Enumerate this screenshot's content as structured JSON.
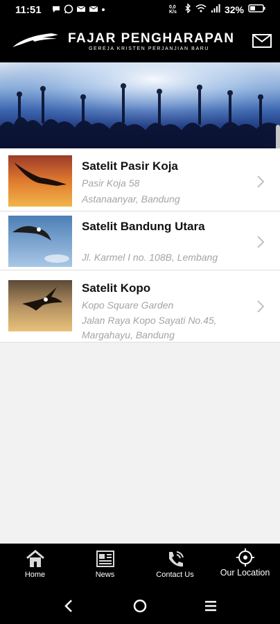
{
  "status_bar": {
    "time": "11:51",
    "speed": "0,0\nK/s",
    "battery": "32%"
  },
  "header": {
    "title": "FAJAR PENGHARAPAN",
    "subtitle": "GEREJA KRISTEN PERJANJIAN BARU"
  },
  "locations": [
    {
      "title": "Satelit Pasir Koja",
      "line1": "Pasir Koja 58",
      "line2": "Astanaanyar, Bandung",
      "line3": ""
    },
    {
      "title": "Satelit Bandung Utara",
      "line1": "",
      "line2": "Jl. Karmel I no. 108B, Lembang",
      "line3": ""
    },
    {
      "title": "Satelit Kopo",
      "line1": "Kopo Square Garden",
      "line2": "Jalan Raya Kopo Sayati No.45,",
      "line3": "Margahayu, Bandung"
    }
  ],
  "bottom_nav": [
    {
      "label": "Home"
    },
    {
      "label": "News"
    },
    {
      "label": "Contact Us"
    },
    {
      "label": "Our Location",
      "active": true
    }
  ],
  "colors": {
    "bar": "#000000",
    "list_bg": "#ffffff",
    "muted_text": "#a4a4a4"
  }
}
